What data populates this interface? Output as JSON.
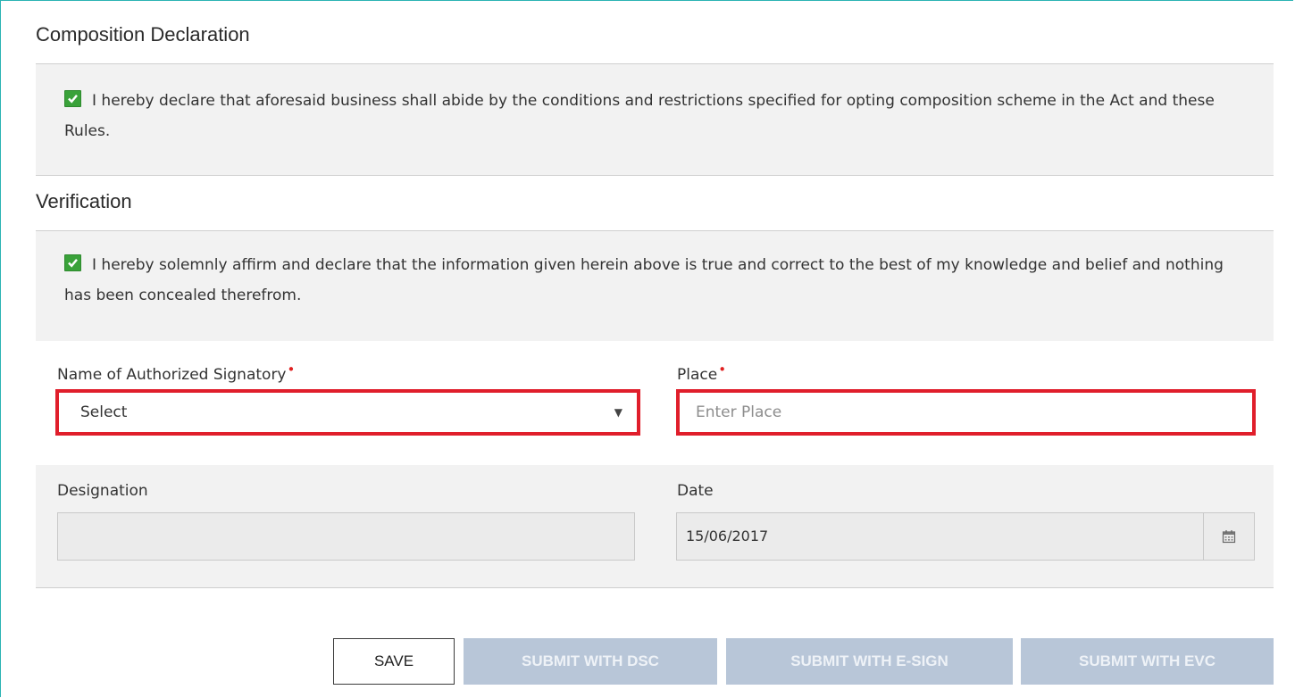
{
  "composition": {
    "title": "Composition Declaration",
    "declaration": "I hereby declare that aforesaid business shall abide by the conditions and restrictions specified for opting composition scheme in the Act and these Rules.",
    "checked": true
  },
  "verification": {
    "title": "Verification",
    "declaration": "I hereby solemnly affirm and declare that the information given herein above is true and correct to the best of my knowledge and belief and nothing has been concealed therefrom.",
    "checked": true
  },
  "form": {
    "signatory_label": "Name of Authorized Signatory",
    "signatory_value": "Select",
    "place_label": "Place",
    "place_placeholder": "Enter Place",
    "designation_label": "Designation",
    "designation_value": "",
    "date_label": "Date",
    "date_value": "15/06/2017",
    "required_marker": "•"
  },
  "buttons": {
    "save": "SAVE",
    "submit_dsc": "SUBMIT WITH DSC",
    "submit_esign": "SUBMIT WITH E-SIGN",
    "submit_evc": "SUBMIT WITH EVC"
  },
  "colors": {
    "checkbox": "#3aa23a",
    "error_border": "#e01e2b",
    "disabled_button": "#b8c6d8",
    "required": "#e02020"
  }
}
